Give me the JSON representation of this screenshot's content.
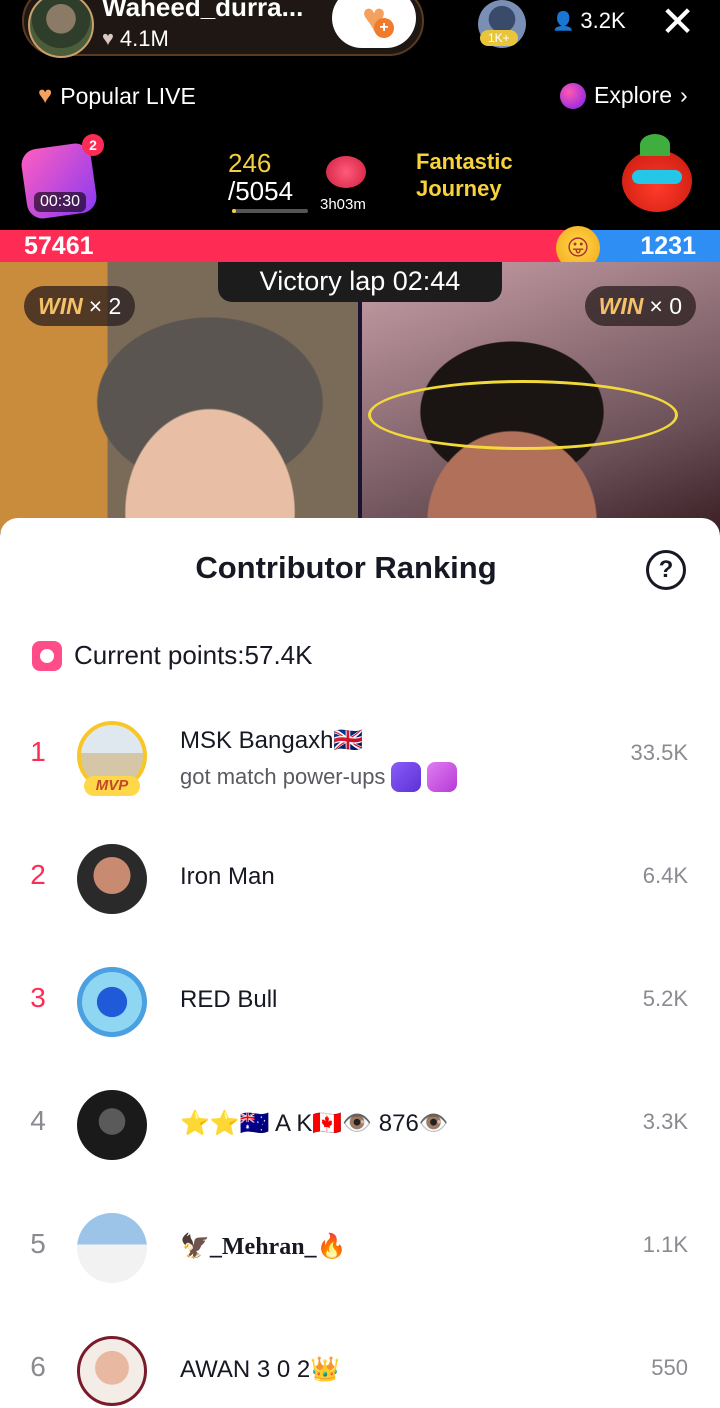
{
  "header": {
    "host_name": "Waheed_durra...",
    "host_likes": "4.1M",
    "viewer_badge": "1K+",
    "viewer_count": "3.2K",
    "popular_label": "Popular LIVE",
    "explore_label": "Explore"
  },
  "promo": {
    "gift_badge_count": "2",
    "gift_timer": "00:30",
    "progress_current": "246",
    "progress_total": "/5054",
    "progress_fraction": 0.05,
    "journey_time": "3h03m",
    "journey_title_line1": "Fantastic",
    "journey_title_line2": "Journey"
  },
  "battle": {
    "score_left": "57461",
    "score_right": "1231",
    "left_share": 0.79,
    "victory_label": "Victory lap 02:44",
    "win_word": "WIN",
    "win_left": "× 2",
    "win_right": "× 0"
  },
  "colors": {
    "accent_red": "#fe2c55",
    "accent_blue": "#2f8ef4",
    "gold": "#f4d03f"
  },
  "sheet": {
    "title": "Contributor Ranking",
    "points_label": "Current points:57.4K",
    "mvp_label": "MVP",
    "rows": [
      {
        "rank": "1",
        "name": "MSK Bangaxh🇬🇧",
        "sub": "got match power-ups",
        "score": "33.5K"
      },
      {
        "rank": "2",
        "name": "Iron Man",
        "score": "6.4K"
      },
      {
        "rank": "3",
        "name": "RED Bull",
        "score": "5.2K"
      },
      {
        "rank": "4",
        "name": "⭐⭐🇦🇺 A K🇨🇦👁️ 876👁️",
        "score": "3.3K"
      },
      {
        "rank": "5",
        "name": "🦅_Mehran_🔥",
        "score": "1.1K"
      },
      {
        "rank": "6",
        "name": "AWAN 3 0 2👑",
        "score": "550"
      }
    ]
  }
}
